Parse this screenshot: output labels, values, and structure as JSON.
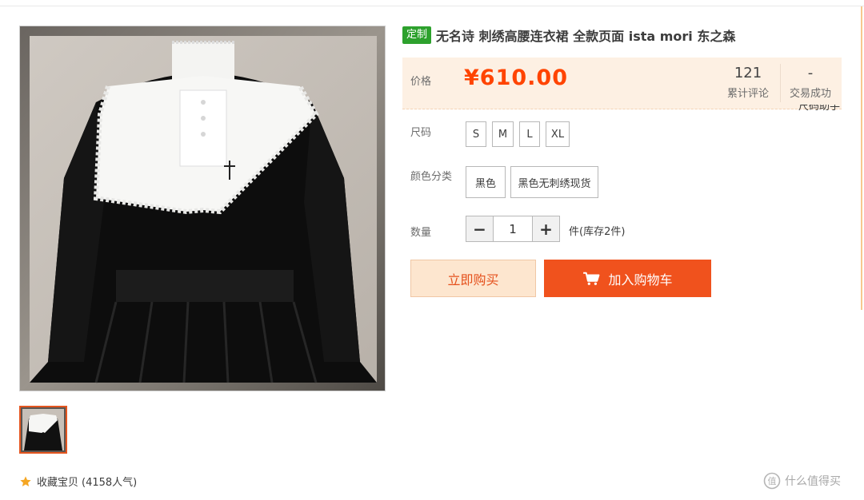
{
  "product": {
    "badge": "定制",
    "title": "无名诗 刺绣高腰连衣裙 全款页面 ista mori 东之森"
  },
  "price_panel": {
    "label": "价格",
    "price": "¥610.00",
    "reviews_count": "121",
    "reviews_label": "累计评论",
    "deals_count": "-",
    "deals_label": "交易成功"
  },
  "size_helper": "尺码助手",
  "options": {
    "size_label": "尺码",
    "sizes": [
      "S",
      "M",
      "L",
      "XL"
    ],
    "color_label": "颜色分类",
    "colors": [
      "黑色",
      "黑色无刺绣现货"
    ]
  },
  "quantity": {
    "label": "数量",
    "minus": "−",
    "value": "1",
    "plus": "+",
    "stock": "件(库存2件)"
  },
  "actions": {
    "buy_now": "立即购买",
    "add_to_cart": "加入购物车"
  },
  "favorite": {
    "label": "收藏宝贝",
    "popularity": "(4158人气)"
  },
  "watermark": "什么值得买",
  "colors": {
    "accent": "#f40",
    "button_orange": "#f0521d",
    "price_bg": "#fdf0e3",
    "badge_green": "#2da12d",
    "star": "#f5a623"
  },
  "icons": {
    "favorite": "star-icon",
    "cart": "cart-icon",
    "watermark": "smzdm-logo-icon"
  }
}
